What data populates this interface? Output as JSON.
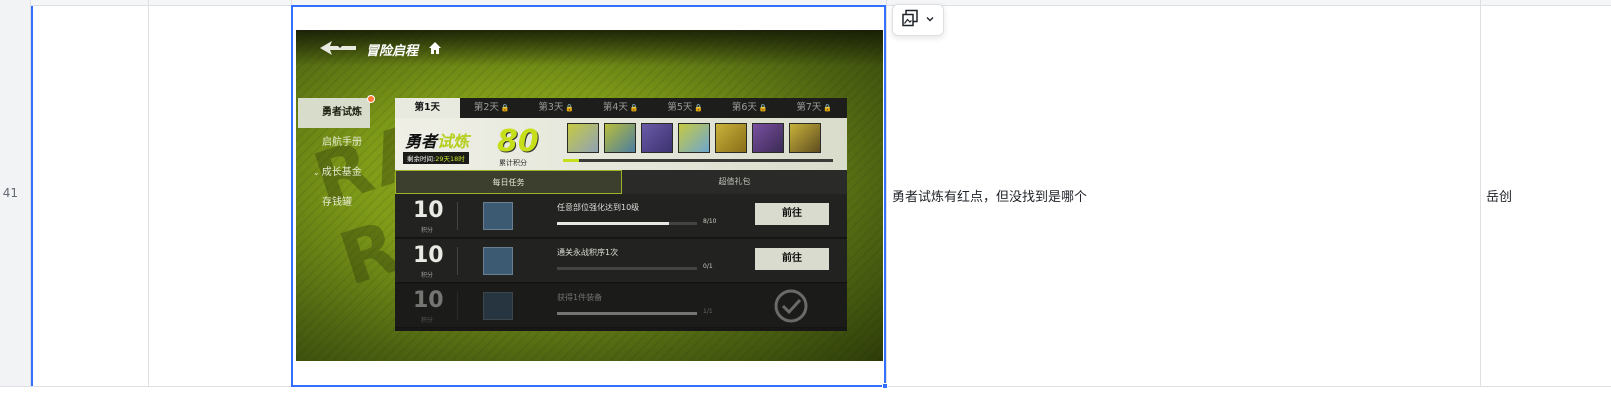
{
  "row": {
    "number": "41",
    "issue_text": "勇者试炼有红点，但没找到是哪个",
    "owner": "岳创"
  },
  "image_toolbar": {
    "icon": "image-layout-icon",
    "dropdown_icon": "chevron-down-icon"
  },
  "game": {
    "title": "冒险启程",
    "background_word": "RAID REWARD",
    "left_menu": [
      "勇者试炼",
      "启航手册",
      "成长基金",
      "存钱罐"
    ],
    "tabs": [
      "第1天",
      "第2天",
      "第3天",
      "第4天",
      "第5天",
      "第6天",
      "第7天"
    ],
    "banner": {
      "title_a": "勇者",
      "title_b": "试炼",
      "remaining_label": "剩余时间:",
      "remaining_value": "29天18时",
      "score": "80",
      "score_label": "累计积分"
    },
    "reward_progress": 0.06,
    "subtabs": [
      "每日任务",
      "超值礼包"
    ],
    "tasks": [
      {
        "points": "10",
        "points_label": "积分",
        "name": "任意部位强化达到10级",
        "count": "8/10",
        "progress": 0.8,
        "button": "前往"
      },
      {
        "points": "10",
        "points_label": "积分",
        "name": "通关永战积序1次",
        "count": "0/1",
        "progress": 0.0,
        "button": "前往"
      },
      {
        "points": "10",
        "points_label": "积分",
        "name": "获得1件装备",
        "count": "1/1",
        "progress": 1.0,
        "button": ""
      }
    ],
    "colors": {
      "accent": "#c7df1a",
      "bg": "#7e9a18",
      "badge": "#ff7a3d"
    }
  }
}
